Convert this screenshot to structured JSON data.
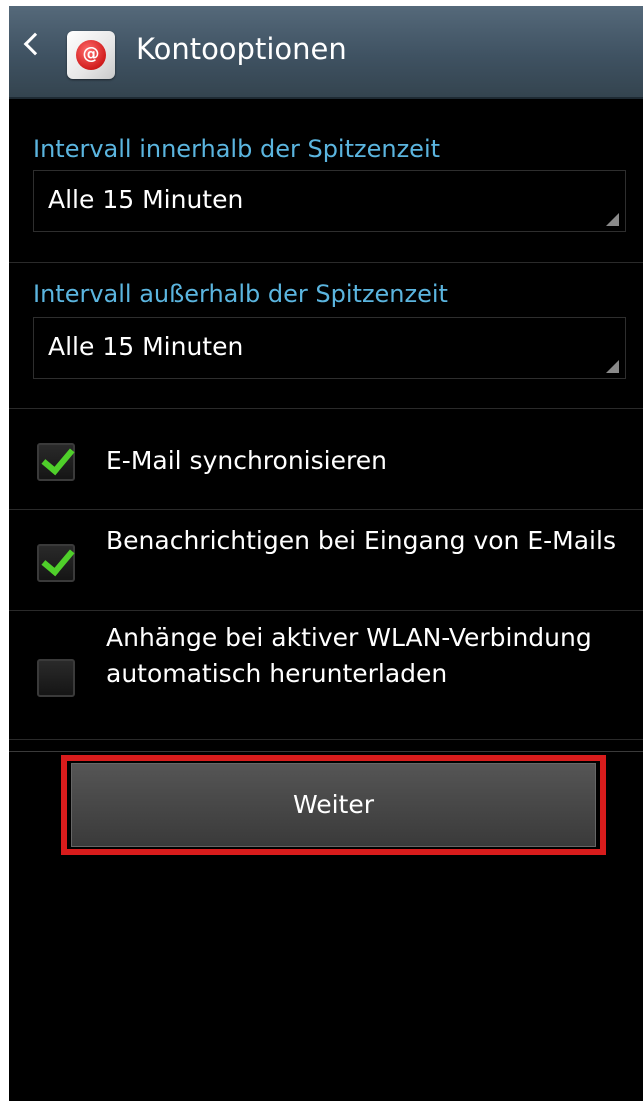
{
  "header": {
    "title": "Kontooptionen",
    "back_icon": "chevron-left-icon",
    "app_icon": "email-app-icon",
    "app_icon_glyph": "@"
  },
  "peak": {
    "label": "Intervall innerhalb der Spitzenzeit",
    "value": "Alle 15 Minuten"
  },
  "offpeak": {
    "label": "Intervall außerhalb der Spitzenzeit",
    "value": "Alle 15 Minuten"
  },
  "options": [
    {
      "label": "E-Mail synchronisieren",
      "checked": true
    },
    {
      "label": "Benachrichtigen bei Eingang von E-Mails",
      "checked": true
    },
    {
      "label": "Anhänge bei aktiver WLAN-Verbindung automatisch herunterladen",
      "checked": false
    }
  ],
  "footer": {
    "next_label": "Weiter"
  },
  "colors": {
    "accent_label": "#5bb5df",
    "check_mark": "#4fcf2a",
    "highlight": "#d81c1c",
    "action_bar": "#3f5262"
  }
}
